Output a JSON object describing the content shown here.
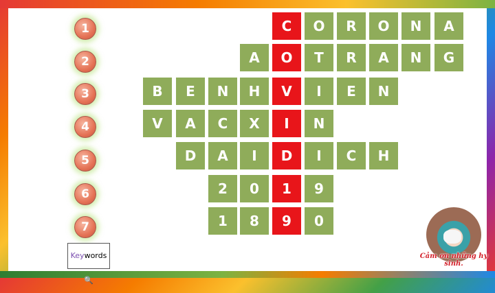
{
  "clue_numbers": [
    "1",
    "2",
    "3",
    "4",
    "5",
    "6",
    "7"
  ],
  "rows": [
    [
      "C",
      "O",
      "R",
      "O",
      "N",
      "A"
    ],
    [
      "A",
      "O",
      "T",
      "R",
      "A",
      "N",
      "G"
    ],
    [
      "B",
      "E",
      "N",
      "H",
      "V",
      "I",
      "E",
      "N"
    ],
    [
      "V",
      "A",
      "C",
      "X",
      "I",
      "N"
    ],
    [
      "D",
      "A",
      "I",
      "D",
      "I",
      "C",
      "H"
    ],
    [
      "2",
      "0",
      "1",
      "9"
    ],
    [
      "1",
      "8",
      "9",
      "0"
    ]
  ],
  "keyword_button": {
    "prefix": "Key",
    "suffix": "words"
  },
  "caption": "Cảm ơn những hy sinh.",
  "colors": {
    "cell": "#8fac5a",
    "key_column": "#e8151a"
  }
}
